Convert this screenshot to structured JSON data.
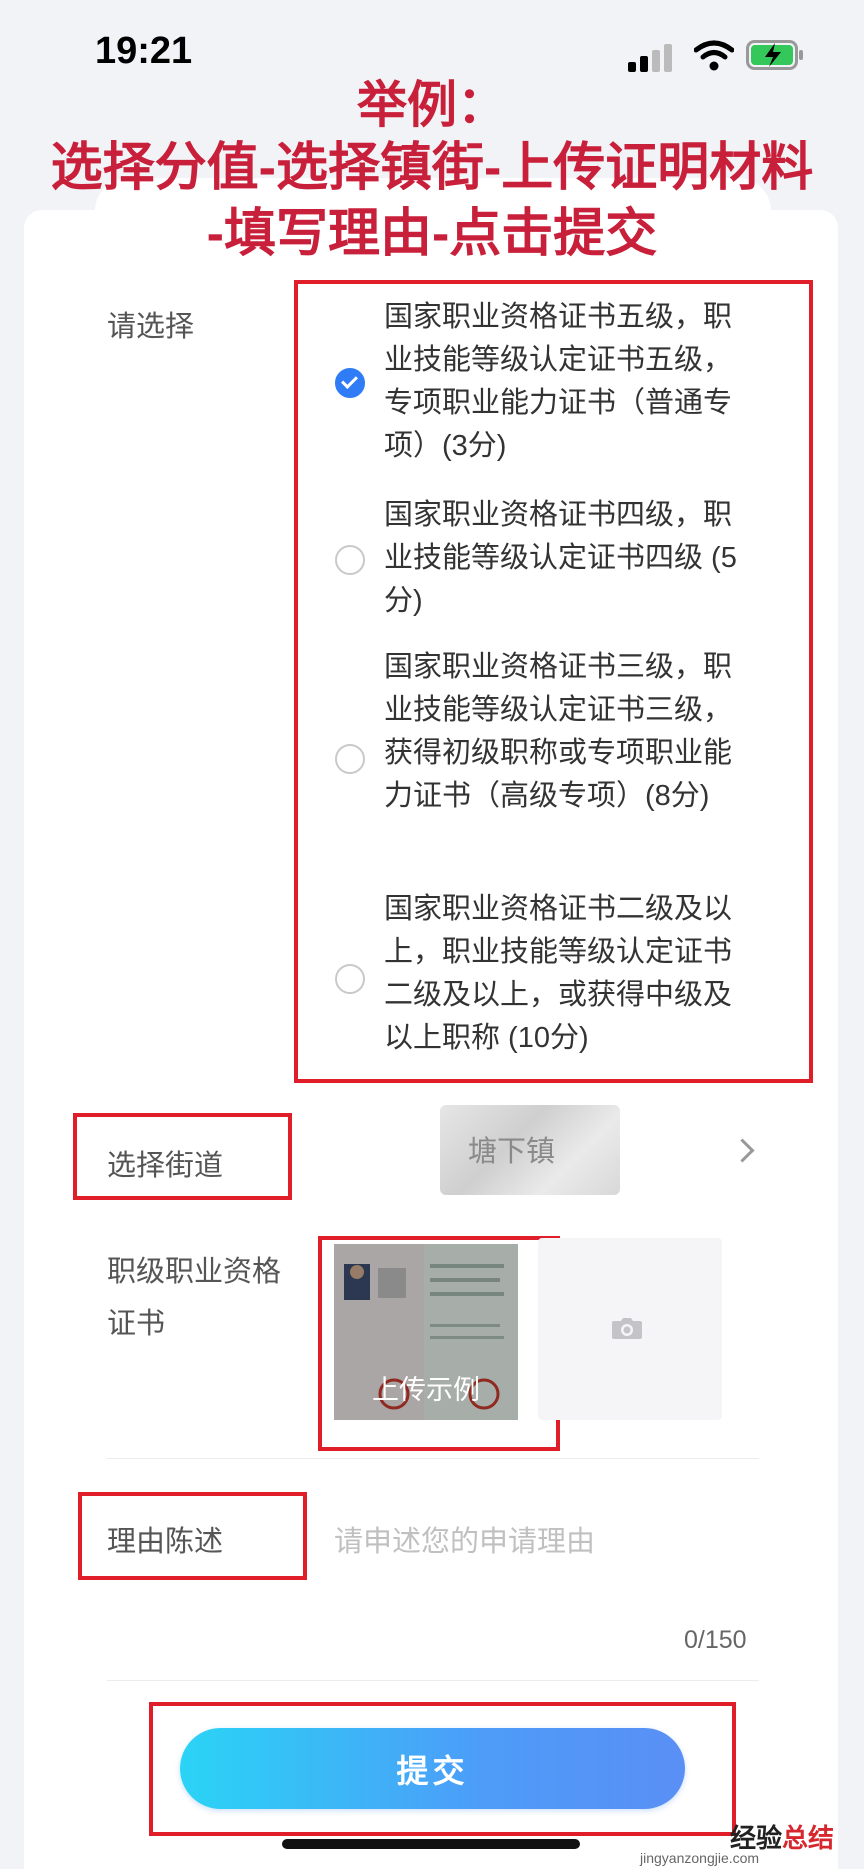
{
  "status": {
    "time": "19:21"
  },
  "annotation": {
    "line1": "举例：",
    "line2": "选择分值-选择镇街-上传证明材料",
    "line3": "-填写理由-点击提交",
    "color": "#c8203a"
  },
  "form": {
    "select_label": "请选择",
    "options": [
      {
        "text": "国家职业资格证书五级，职业技能等级认定证书五级，专项职业能力证书（普通专项）(3分)",
        "checked": true
      },
      {
        "text": "国家职业资格证书四级，职业技能等级认定证书四级 (5分)",
        "checked": false
      },
      {
        "text": "国家职业资格证书三级，职业技能等级认定证书三级，获得初级职称或专项职业能力证书（高级专项）(8分)",
        "checked": false
      },
      {
        "text": "国家职业资格证书二级及以上，职业技能等级认定证书二级及以上，或获得中级及以上职称 (10分)",
        "checked": false
      }
    ],
    "street_label": "选择街道",
    "street_value": "塘下镇",
    "certificate_label": "职级职业资格证书",
    "sample_label": "上传示例",
    "reason_label": "理由陈述",
    "reason_placeholder": "请申述您的申请理由",
    "counter": "0/150",
    "submit_label": "提交",
    "accent_color": "#2f7cf6",
    "highlight_color": "#e01e2a"
  },
  "watermark": {
    "text_a": "经验",
    "text_b": "总结",
    "sub": "jingyanzongjie.com"
  },
  "icons": [
    "signal-icon",
    "wifi-icon",
    "battery-charging-icon",
    "chevron-right-icon",
    "camera-icon",
    "check-icon"
  ]
}
